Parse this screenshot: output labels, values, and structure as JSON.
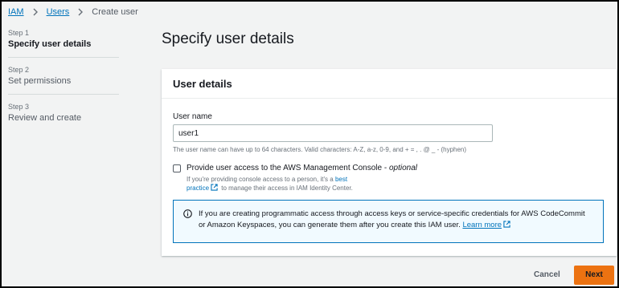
{
  "breadcrumb": {
    "items": [
      "IAM",
      "Users"
    ],
    "current": "Create user"
  },
  "steps": [
    {
      "num": "Step 1",
      "name": "Specify user details"
    },
    {
      "num": "Step 2",
      "name": "Set permissions"
    },
    {
      "num": "Step 3",
      "name": "Review and create"
    }
  ],
  "page": {
    "title": "Specify user details"
  },
  "user_details": {
    "header": "User details",
    "username_label": "User name",
    "username_value": "user1",
    "username_hint": "The user name can have up to 64 characters. Valid characters: A-Z, a-z, 0-9, and + = , . @ _ - (hyphen)",
    "console_access_label": "Provide user access to the AWS Management Console - ",
    "console_access_optional": "optional",
    "console_access_checked": false,
    "console_desc_before": "If you're providing console access to a person, it's a ",
    "console_desc_link": "best practice",
    "console_desc_after": " to manage their access in IAM Identity Center.",
    "info_text": "If you are creating programmatic access through access keys or service-specific credentials for AWS CodeCommit or Amazon Keyspaces, you can generate them after you create this IAM user. ",
    "info_link": "Learn more"
  },
  "footer": {
    "cancel_label": "Cancel",
    "next_label": "Next"
  },
  "colors": {
    "link": "#0073bb",
    "primary_button": "#ec7211",
    "info_bg": "#f1faff"
  },
  "icons": [
    "chevron-right-icon",
    "external-link-icon",
    "info-icon"
  ]
}
